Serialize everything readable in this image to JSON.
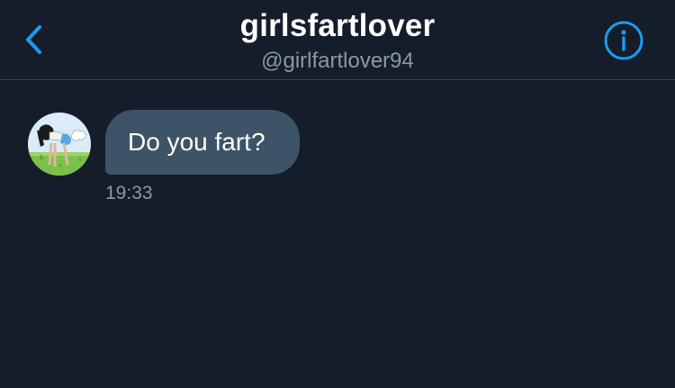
{
  "header": {
    "title": "girlsfartlover",
    "handle": "@girlfartlover94",
    "back_icon": "chevron-left-icon",
    "info_icon": "info-icon"
  },
  "conversation": {
    "messages": [
      {
        "sender": "received",
        "avatar_icon": "avatar-icon",
        "text": "Do you fart?",
        "time": "19:33"
      }
    ]
  },
  "colors": {
    "background": "#151d2a",
    "accent": "#1d9bf0",
    "received_bubble": "#3d5466",
    "secondary_text": "#8899a6",
    "divider": "#38444d"
  }
}
